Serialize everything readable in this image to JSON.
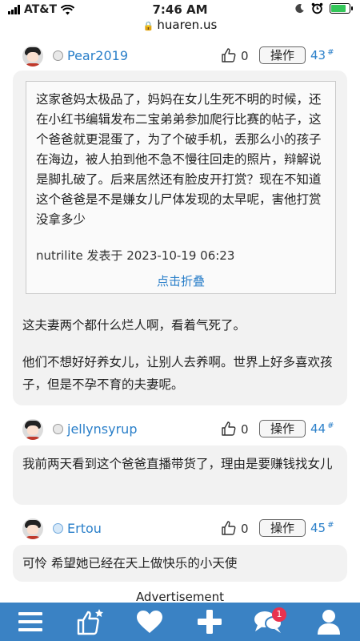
{
  "status_bar": {
    "carrier": "AT&T",
    "time": "7:46 AM",
    "battery_percent": 85
  },
  "browser": {
    "url": "huaren.us"
  },
  "colors": {
    "link": "#2a7fc9",
    "nav_bg": "#3a82c4",
    "badge": "#e8324f"
  },
  "op_label": "操作",
  "posts": [
    {
      "username": "Pear2019",
      "likes": "0",
      "floor": "43",
      "floor_mark": "#",
      "quote": {
        "text": "这家爸妈太极品了，妈妈在女儿生死不明的时候，还在小红书编辑发布二宝弟弟参加爬行比赛的帖子，这个爸爸就更混蛋了，为了个破手机，丢那么小的孩子在海边，被人拍到他不急不慢往回走的照片，辩解说是脚扎破了。后来居然还有脸皮开打赏？现在不知道这个爸爸是不是嫌女儿尸体发现的太早呢，害他打赏没拿多少",
        "meta": "nutrilite 发表于 2023-10-19 06:23",
        "collapse_label": "点击折叠"
      },
      "paragraphs": [
        "这夫妻两个都什么烂人啊，看着气死了。",
        "他们不想好好养女儿，让别人去养啊。世界上好多喜欢孩子，但是不孕不育的夫妻呢。"
      ]
    },
    {
      "username": "jellynsyrup",
      "likes": "0",
      "floor": "44",
      "floor_mark": "#",
      "text": "我前两天看到这个爸爸直播带货了，理由是要赚钱找女儿"
    },
    {
      "username": "Ertou",
      "likes": "0",
      "floor": "45",
      "floor_mark": "#",
      "text": "可怜 希望她已经在天上做快乐的小天使"
    }
  ],
  "advertisement_label": "Advertisement",
  "nav": {
    "icons": [
      "menu-icon",
      "like-star-icon",
      "heart-icon",
      "plus-icon",
      "chat-icon",
      "user-icon"
    ],
    "chat_badge": "1"
  }
}
